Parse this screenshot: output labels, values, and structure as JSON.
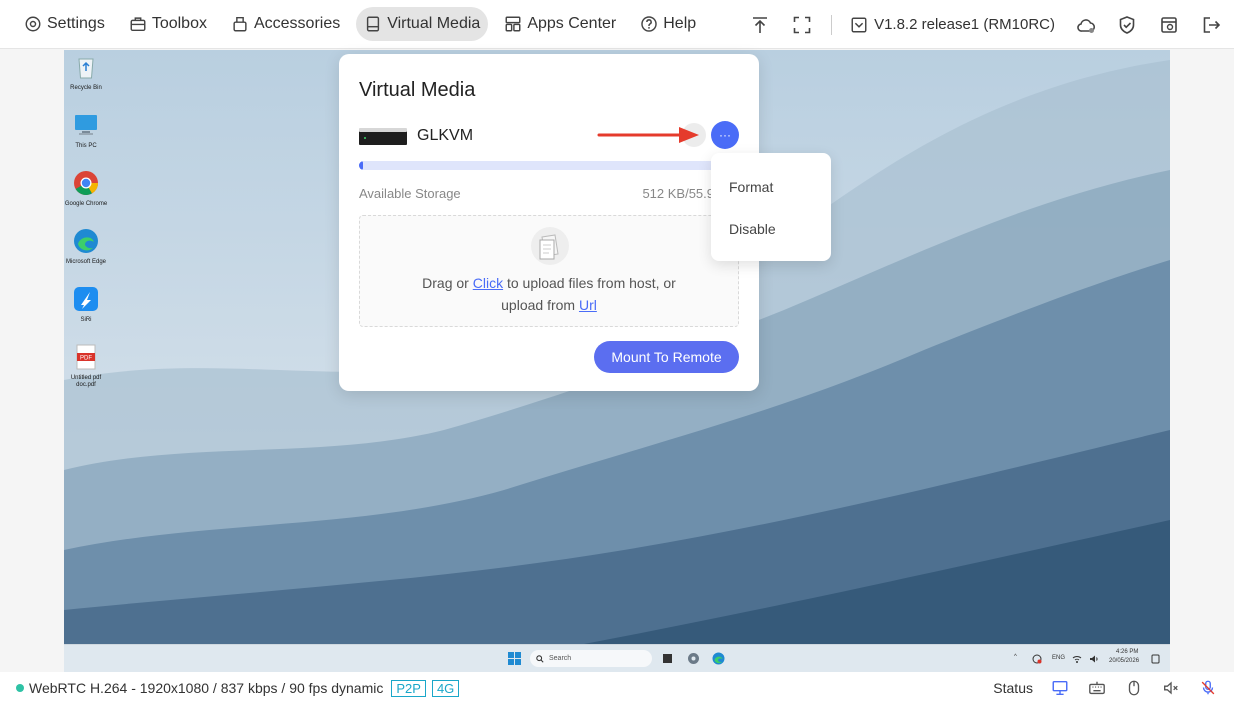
{
  "nav": {
    "items": [
      {
        "label": "Settings",
        "icon": "settings-icon"
      },
      {
        "label": "Toolbox",
        "icon": "toolbox-icon"
      },
      {
        "label": "Accessories",
        "icon": "accessories-icon"
      },
      {
        "label": "Virtual Media",
        "icon": "drive-icon",
        "active": true
      },
      {
        "label": "Apps Center",
        "icon": "apps-icon"
      },
      {
        "label": "Help",
        "icon": "help-icon"
      }
    ],
    "version": "V1.8.2 release1 (RM10RC)"
  },
  "panel": {
    "title": "Virtual Media",
    "drive_name": "GLKVM",
    "more_glyph": "···",
    "storage_label": "Available Storage",
    "storage_value": "512 KB/55.9",
    "storage_fraction": 0.01,
    "upload": {
      "prefix": "Drag or ",
      "click_link": "Click",
      "middle": " to upload files from host, or",
      "line2_prefix": "upload from ",
      "url_link": "Url"
    },
    "mount_button": "Mount To Remote"
  },
  "menu": {
    "items": [
      "Format",
      "Disable"
    ]
  },
  "desktop": {
    "icons": [
      "Recycle Bin",
      "This PC",
      "Google Chrome",
      "Microsoft Edge",
      "SiRi",
      "Untitled pdf doc.pdf"
    ],
    "search_placeholder": "Search",
    "tray_lang": "ENG",
    "tray_time": "4:26 PM",
    "tray_date": "20/05/2026"
  },
  "status": {
    "stream_info": "WebRTC H.264 - 1920x1080 / 837 kbps / 90 fps dynamic",
    "badge_p2p": "P2P",
    "badge_4g": "4G",
    "status_label": "Status"
  },
  "colors": {
    "accent": "#4a6cf7",
    "status_dot": "#2ec2a5",
    "arrow": "#e53b2c"
  }
}
